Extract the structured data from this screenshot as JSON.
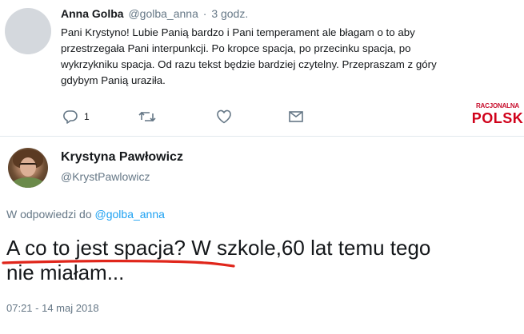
{
  "reply_tweet": {
    "author_name": "Anna Golba",
    "author_handle": "@golba_anna",
    "time_separator": "·",
    "time_ago": "3 godz.",
    "text": "Pani Krystyno! Lubie Panią bardzo i Pani temperament ale błagam o to aby przestrzegała Pani interpunkcji. Po kropce spacja, po przecinku spacja, po wykrzykniku spacja. Od razu tekst będzie bardziej czytelny. Przepraszam z góry gdybym Panią uraziła.",
    "actions": {
      "reply_count": "1",
      "retweet_count": "",
      "like_count": ""
    }
  },
  "watermark": {
    "line1": "RACJONALNA",
    "line2": "POLSK"
  },
  "main_tweet": {
    "author_name": "Krystyna Pawłowicz",
    "author_handle": "@KrystPawlowicz",
    "reply_to_prefix": "W odpowiedzi do",
    "reply_to_handle": "@golba_anna",
    "text": "A co to jest spacja? W szkole,60 lat temu tego\nnie miałam...",
    "timestamp": "07:21 - 14 maj 2018"
  },
  "colors": {
    "link": "#1da1f2",
    "meta": "#657786",
    "text": "#14171a",
    "divider": "#e1e8ed",
    "annotation_underline": "#e0261b",
    "watermark": "#d0021b"
  },
  "icons": [
    "reply-icon",
    "retweet-icon",
    "like-icon",
    "message-icon"
  ]
}
